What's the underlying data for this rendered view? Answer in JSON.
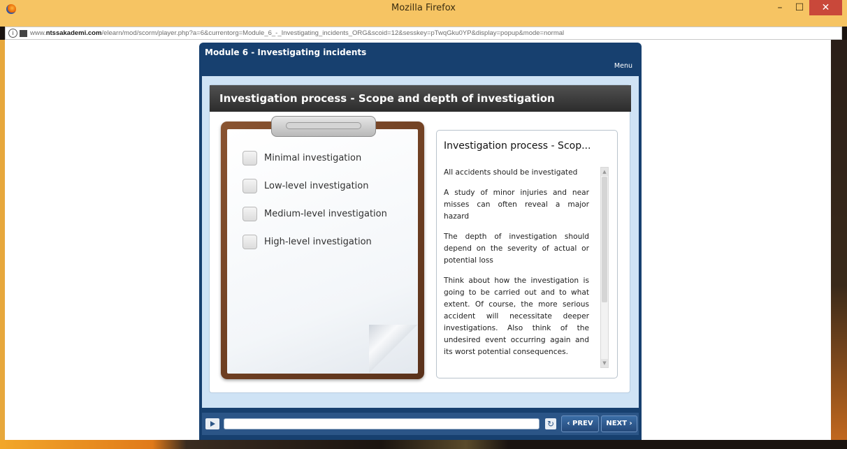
{
  "window": {
    "title": "Mozilla Firefox",
    "minimize": "–",
    "maximize": "☐",
    "close": "✕"
  },
  "address": {
    "info_glyph": "i",
    "url_prefix": "www.",
    "url_domain": "ntssakademi.com",
    "url_path": "/elearn/mod/scorm/player.php?a=6&currentorg=Module_6_-_Investigating_incidents_ORG&scoid=12&sesskey=pTwqGku0YP&display=popup&mode=normal"
  },
  "player": {
    "module_title": "Module 6 - Investigating incidents",
    "menu_label": "Menu",
    "slide_title": "Investigation process - Scope and depth of investigation",
    "options": [
      {
        "label": "Minimal investigation"
      },
      {
        "label": "Low-level investigation"
      },
      {
        "label": "Medium-level investigation"
      },
      {
        "label": "High-level investigation"
      }
    ],
    "panel": {
      "title": "Investigation process - Scop...",
      "paragraphs": [
        "All accidents should be investigated",
        "A study of minor injuries and near misses can often reveal a major hazard",
        "The depth of investigation should depend on the severity of actual or potential loss",
        "Think about how the investigation is going to be carried out and to what extent. Of course, the more serious accident will necessitate deeper investigations. Also think of the undesired event occurring again and its worst potential consequences."
      ],
      "scroll_up": "▲",
      "scroll_down": "▼"
    },
    "controls": {
      "play_icon": "play-icon",
      "replay_glyph": "↻",
      "progress_fraction": 0.0,
      "prev_label": "‹ PREV",
      "next_label": "NEXT ›"
    }
  },
  "colors": {
    "titlebar": "#f6c463",
    "player_bg": "#17406f",
    "stage_bg": "#cfe3f5",
    "accent": "#2b5587"
  }
}
